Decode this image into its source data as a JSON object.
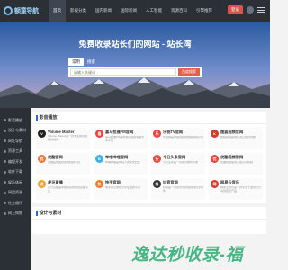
{
  "header": {
    "logo_text": "额童导航",
    "nav": [
      {
        "label": "首页"
      },
      {
        "label": "影视分类"
      },
      {
        "label": "国内新闻"
      },
      {
        "label": "国际新闻"
      },
      {
        "label": "人工智能"
      },
      {
        "label": "资源百科"
      },
      {
        "label": "引擎推荐"
      }
    ],
    "login_label": "登录"
  },
  "hero": {
    "title": "免费收录站长们的网站 - 站长湾",
    "tabs": [
      {
        "label": "常用"
      },
      {
        "label": "搜索"
      }
    ],
    "search_placeholder": "请输入关键词",
    "search_button": "百度搜索"
  },
  "sidebar": {
    "items": [
      {
        "label": "影音播放"
      },
      {
        "label": "设计与素材"
      },
      {
        "label": "网址导航"
      },
      {
        "label": "资源工具"
      },
      {
        "label": "编程开发"
      },
      {
        "label": "软件下载"
      },
      {
        "label": "娱乐休闲"
      },
      {
        "label": "网盘资源"
      },
      {
        "label": "社交通讯"
      },
      {
        "label": "网上购物"
      }
    ]
  },
  "main": {
    "section1_title": "影音播放",
    "cards": [
      {
        "name": "Volume Master",
        "desc": "Volume Master是一款专业的音量控制插件",
        "color": "#222222",
        "glyph": "V"
      },
      {
        "name": "喜马拉雅FM官网",
        "desc": "喜马拉雅FM是中国领先的音频分享平台",
        "color": "#e8453c",
        "glyph": "喜"
      },
      {
        "name": "乐视TV官网",
        "desc": "乐视网是中国领先的网络视频平台",
        "color": "#e8453c",
        "glyph": "乐"
      },
      {
        "name": "搜狐视频官网",
        "desc": "搜狐视频提供高清正版影视剧",
        "color": "#d33a2c",
        "glyph": "K"
      },
      {
        "name": "优酷官网",
        "desc": "优酷是中国领先的视频平台",
        "color": "#e8773c",
        "glyph": "优"
      },
      {
        "name": "哔哩哔哩官网",
        "desc": "哔哩哔哩是年轻人的文化社区",
        "color": "#3cb0e8",
        "glyph": "B"
      },
      {
        "name": "今日头条官网",
        "desc": "今日头条是一款资讯推荐引擎",
        "color": "#e8453c",
        "glyph": "头"
      },
      {
        "name": "优酷视频官网",
        "desc": "优酷视频提供正版高清视频",
        "color": "#e8453c",
        "glyph": "优"
      },
      {
        "name": "虎牙直播",
        "desc": "虎牙直播是中国领先的游戏直播平台",
        "color": "#f0a030",
        "glyph": "虎"
      },
      {
        "name": "快手官网",
        "desc": "快手是记录和分享生活的平台",
        "color": "#f07a2c",
        "glyph": "快"
      },
      {
        "name": "抖音官网",
        "desc": "抖音是一款音乐创意短视频社交软件",
        "color": "#333333",
        "glyph": "抖"
      },
      {
        "name": "网易云音乐",
        "desc": "网易云音乐是一款专注于发现与分享的音乐产品",
        "color": "#d33a2c",
        "glyph": "网"
      }
    ],
    "section2_title": "设计与素材"
  },
  "watermark": "逸达秒收录-福"
}
